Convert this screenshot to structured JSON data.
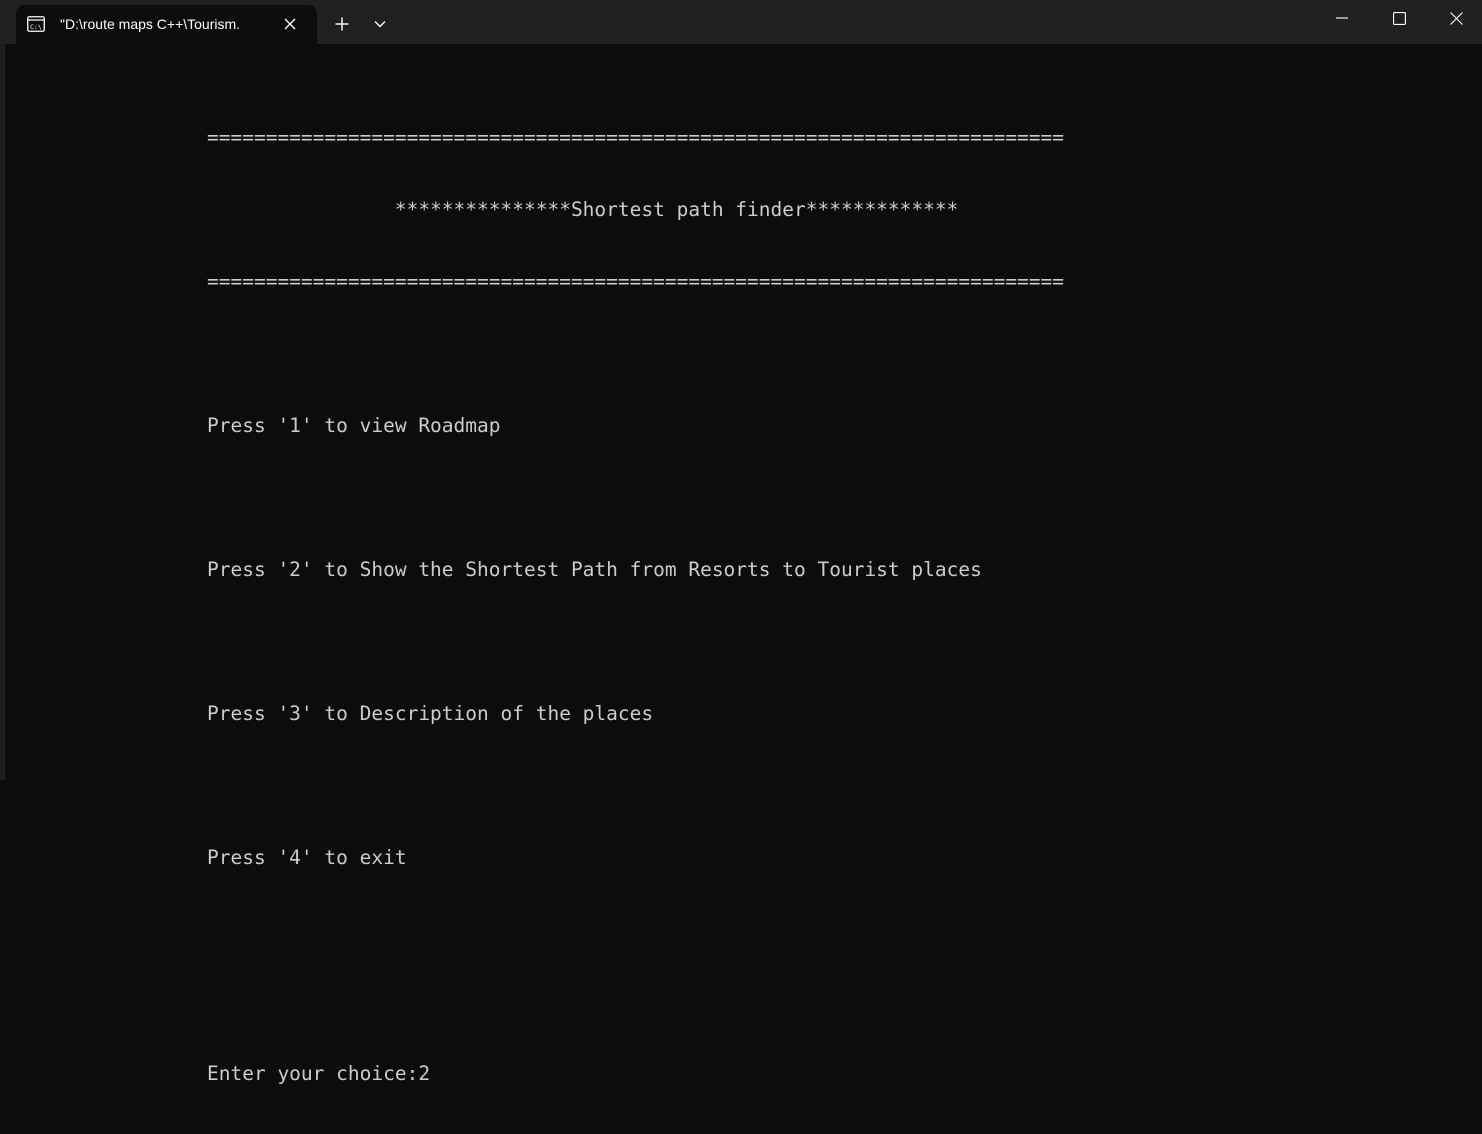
{
  "tab": {
    "title": "\"D:\\route maps C++\\Tourism.",
    "icon": "terminal-icon"
  },
  "titlebar_icons": {
    "close_tab": "close-icon",
    "new_tab": "plus-icon",
    "dropdown": "chevron-down-icon",
    "minimize": "minimize-icon",
    "maximize": "maximize-icon",
    "close_window": "close-icon"
  },
  "terminal": {
    "lines": [
      "=========================================================================",
      "                ***************Shortest path finder*************",
      "=========================================================================",
      "",
      "Press '1' to view Roadmap",
      "",
      "Press '2' to Show the Shortest Path from Resorts to Tourist places",
      "",
      "Press '3' to Description of the places",
      "",
      "Press '4' to exit",
      "",
      "",
      "Enter your choice:2"
    ]
  },
  "colors": {
    "background": "#0c0c0c",
    "titlebar": "#202020",
    "foreground": "#cccccc"
  }
}
